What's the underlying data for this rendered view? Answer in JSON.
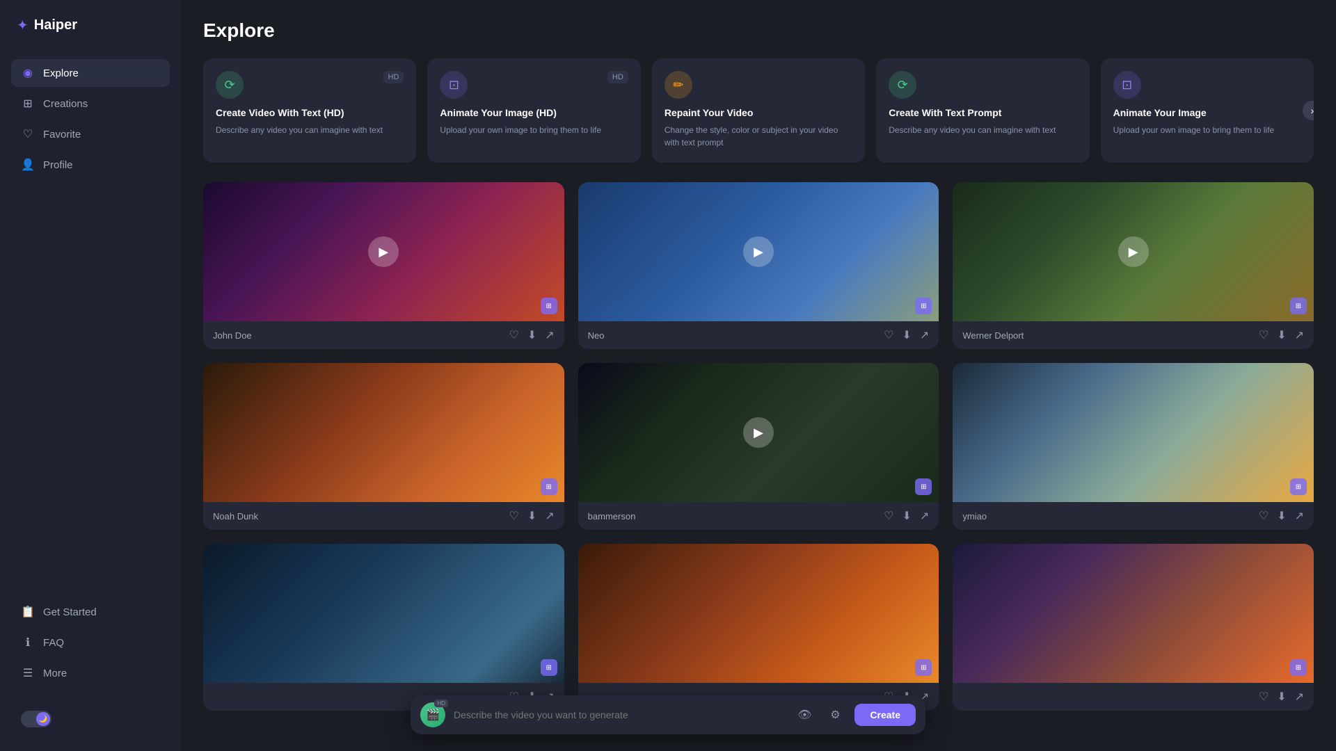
{
  "app": {
    "name": "Haiper",
    "logo_icon": "✦"
  },
  "sidebar": {
    "nav_items": [
      {
        "id": "explore",
        "label": "Explore",
        "icon": "◉",
        "active": true
      },
      {
        "id": "creations",
        "label": "Creations",
        "icon": "⊞"
      },
      {
        "id": "favorite",
        "label": "Favorite",
        "icon": "♡"
      },
      {
        "id": "profile",
        "label": "Profile",
        "icon": "👤"
      }
    ],
    "bottom_items": [
      {
        "id": "get-started",
        "label": "Get Started",
        "icon": "📋"
      },
      {
        "id": "faq",
        "label": "FAQ",
        "icon": "ℹ"
      },
      {
        "id": "more",
        "label": "More",
        "icon": "☰"
      }
    ],
    "toggle_label": "Dark mode"
  },
  "page": {
    "title": "Explore"
  },
  "feature_cards": [
    {
      "id": "create-video-hd",
      "title": "Create Video With Text (HD)",
      "desc": "Describe any video you can imagine with text",
      "icon_type": "green",
      "icon": "⟳",
      "badge": "HD"
    },
    {
      "id": "animate-image-hd",
      "title": "Animate Your Image (HD)",
      "desc": "Upload your own image to bring them to life",
      "icon_type": "purple",
      "icon": "⊡",
      "badge": "HD"
    },
    {
      "id": "repaint-video",
      "title": "Repaint Your Video",
      "desc": "Change the style, color or subject in your video with text prompt",
      "icon_type": "orange",
      "icon": "✏",
      "badge": ""
    },
    {
      "id": "create-text-prompt",
      "title": "Create With Text Prompt",
      "desc": "Describe any video you can imagine with text",
      "icon_type": "green",
      "icon": "⟳",
      "badge": ""
    },
    {
      "id": "animate-your-image",
      "title": "Animate Your Image",
      "desc": "Upload your own image to bring them to life",
      "icon_type": "purple",
      "icon": "⊡",
      "badge": ""
    }
  ],
  "videos": [
    {
      "id": "v1",
      "author": "John Doe",
      "thumb_class": "thumb-bears",
      "has_play": true
    },
    {
      "id": "v2",
      "author": "Neo",
      "thumb_class": "thumb-mario",
      "has_play": true
    },
    {
      "id": "v3",
      "author": "Werner Delport",
      "thumb_class": "thumb-cat",
      "has_play": true
    },
    {
      "id": "v4",
      "author": "Noah Dunk",
      "thumb_class": "thumb-desert",
      "has_play": false
    },
    {
      "id": "v5",
      "author": "bammerson",
      "thumb_class": "thumb-ghost",
      "has_play": true
    },
    {
      "id": "v6",
      "author": "ymiao",
      "thumb_class": "thumb-panda",
      "has_play": false
    },
    {
      "id": "v7",
      "author": "",
      "thumb_class": "thumb-temple",
      "has_play": false
    },
    {
      "id": "v8",
      "author": "",
      "thumb_class": "thumb-fire",
      "has_play": false
    },
    {
      "id": "v9",
      "author": "",
      "thumb_class": "thumb-sunset",
      "has_play": false
    }
  ],
  "prompt_bar": {
    "placeholder": "Describe the video you want to generate",
    "create_label": "Create"
  }
}
